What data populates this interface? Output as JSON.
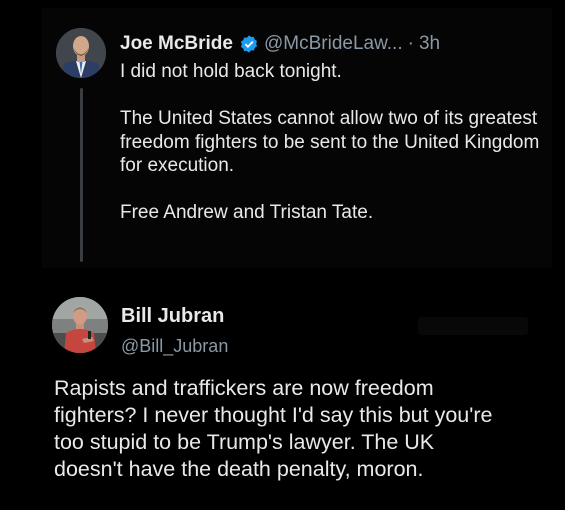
{
  "original_tweet": {
    "display_name": "Joe McBride",
    "verified": true,
    "handle": "@McBrideLaw...",
    "separator": "·",
    "time": "3h",
    "paragraphs": [
      "I did not hold back tonight.",
      "The United States cannot allow two of its greatest freedom fighters to be sent to the United Kingdom for execution.",
      "Free Andrew and Tristan Tate."
    ],
    "avatar_icon": "profile-photo-man-in-suit"
  },
  "reply_tweet": {
    "display_name": "Bill Jubran",
    "handle": "@Bill_Jubran",
    "body_lines": [
      "Rapists and traffickers are now freedom",
      "fighters? I never thought I'd say this but you're",
      "too stupid to be Trump's lawyer. The UK",
      "doesn't have the death penalty, moron."
    ],
    "avatar_icon": "profile-photo-man-red-shirt"
  },
  "colors": {
    "background": "#000000",
    "primary_text": "#e7e9ea",
    "secondary_text": "#8b98a5",
    "verified_badge": "#1d9bf0",
    "thread_line": "#3a3d41"
  }
}
